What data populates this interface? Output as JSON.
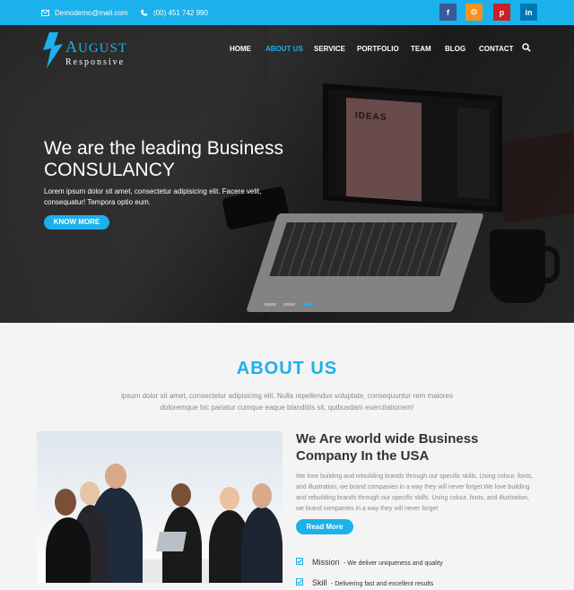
{
  "topbar": {
    "email": "Demodemo@mail.com",
    "phone": "(00) 451 742 990",
    "social": [
      {
        "icon": "facebook-icon",
        "glyph": "f"
      },
      {
        "icon": "rss-icon",
        "glyph": "⊙"
      },
      {
        "icon": "pinterest-icon",
        "glyph": "p"
      },
      {
        "icon": "linkedin-icon",
        "glyph": "in"
      }
    ]
  },
  "logo": {
    "initial": "A",
    "rest": "UGUST",
    "tagline": "Responsive"
  },
  "nav": {
    "items": [
      "HOME",
      "ABOUT US",
      "SERVICE",
      "PORTFOLIO",
      "TEAM",
      "BLOG",
      "CONTACT"
    ],
    "active": "ABOUT US"
  },
  "hero": {
    "title_line1": "We are the leading Business",
    "title_line2": "CONSULANCY",
    "text": "Lorem ipsum dolor sit amet, consectetur adipisicing elit. Facere velit, consequatur! Tempora optio eum.",
    "button": "KNOW MORE",
    "screen_text": "IDEAS",
    "active_slide": 3
  },
  "about": {
    "title": "ABOUT US",
    "intro": "ipsum dolor sit amet, consectetur adipisicing elit. Nulla repellendus voluptate, consequuntur rem maiores doloremque hic pariatur cumque eaque blanditiis sit, quibusdam exercitationem!",
    "sub_title_line1": "We Are world wide Business",
    "sub_title_line2": "Company In the USA",
    "sub_text": "We love building and rebuilding brands through our specific skills. Using colour, fonts, and illustration, we brand companies in a way they will never forget.We love building and rebuilding brands through our specific skills. Using colour, fonts, and illustration, we brand companies in a way they will never forget",
    "button": "Read More",
    "features": [
      {
        "label": "Mission",
        "desc": "- We deliver uniqueness and quality"
      },
      {
        "label": "Skill",
        "desc": "- Delivering fast and excellent results"
      }
    ]
  },
  "colors": {
    "accent": "#1bb1ec",
    "topbar": "#1bb1ec"
  }
}
